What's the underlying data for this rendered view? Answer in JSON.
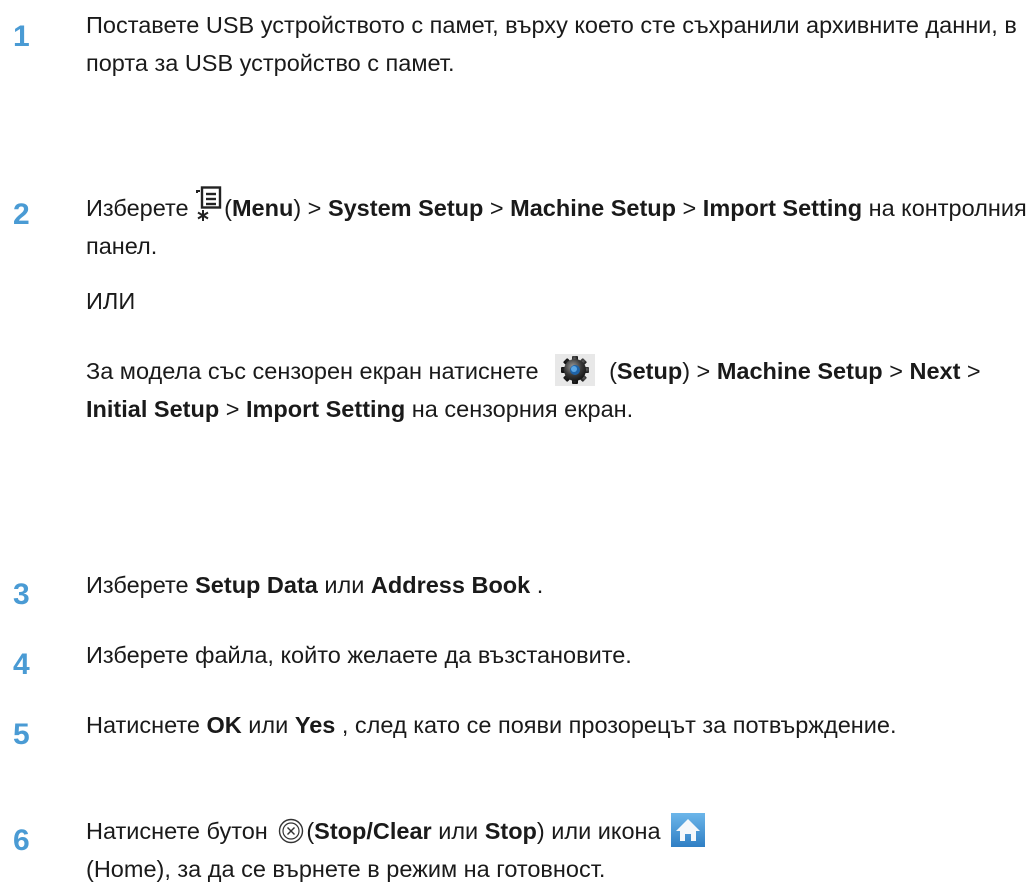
{
  "steps": [
    {
      "number": "1",
      "text": "Поставете USB устройството с памет, върху което сте съхранили архивните данни, в порта за USB устройство с памет."
    },
    {
      "number": "2",
      "lead": "Изберете ",
      "menu_label": "Menu",
      "sep": " > ",
      "system_setup": "System Setup",
      "machine_setup": "Machine Setup",
      "import_setting": "Import Setting",
      "tail": " на контролния панел.",
      "or_text": "ИЛИ",
      "touch_lead": "За модела със сензорен екран натиснете ",
      "setup_label": "Setup",
      "next": "Next",
      "initial_setup": "Initial Setup",
      "touch_tail": " на сензорния екран."
    },
    {
      "number": "3",
      "lead": "Изберете ",
      "setup_data": "Setup Data",
      "or_word": " или ",
      "address_book": "Address Book",
      "tail": " ."
    },
    {
      "number": "4",
      "text": "Изберете файла, който желаете да възстановите."
    },
    {
      "number": "5",
      "lead": "Натиснете ",
      "ok": "OK",
      "or_word": " или ",
      "yes": "Yes",
      "tail": " , след като се появи прозорецът за потвърждение."
    },
    {
      "number": "6",
      "lead": "Натиснете бутон ",
      "stop_clear": "Stop/Clear",
      "or_word": " или ",
      "stop": "Stop",
      "mid": ") или икона ",
      "home": "(Home)",
      "tail": ", за да се върнете в режим на готовност."
    }
  ],
  "icons": {
    "menu": "menu-icon",
    "setup": "gear-icon",
    "stop": "stop-clear-icon",
    "home": "home-icon"
  },
  "colors": {
    "step_number": "#4a9bd4",
    "home_icon": "#3a8fd0"
  }
}
